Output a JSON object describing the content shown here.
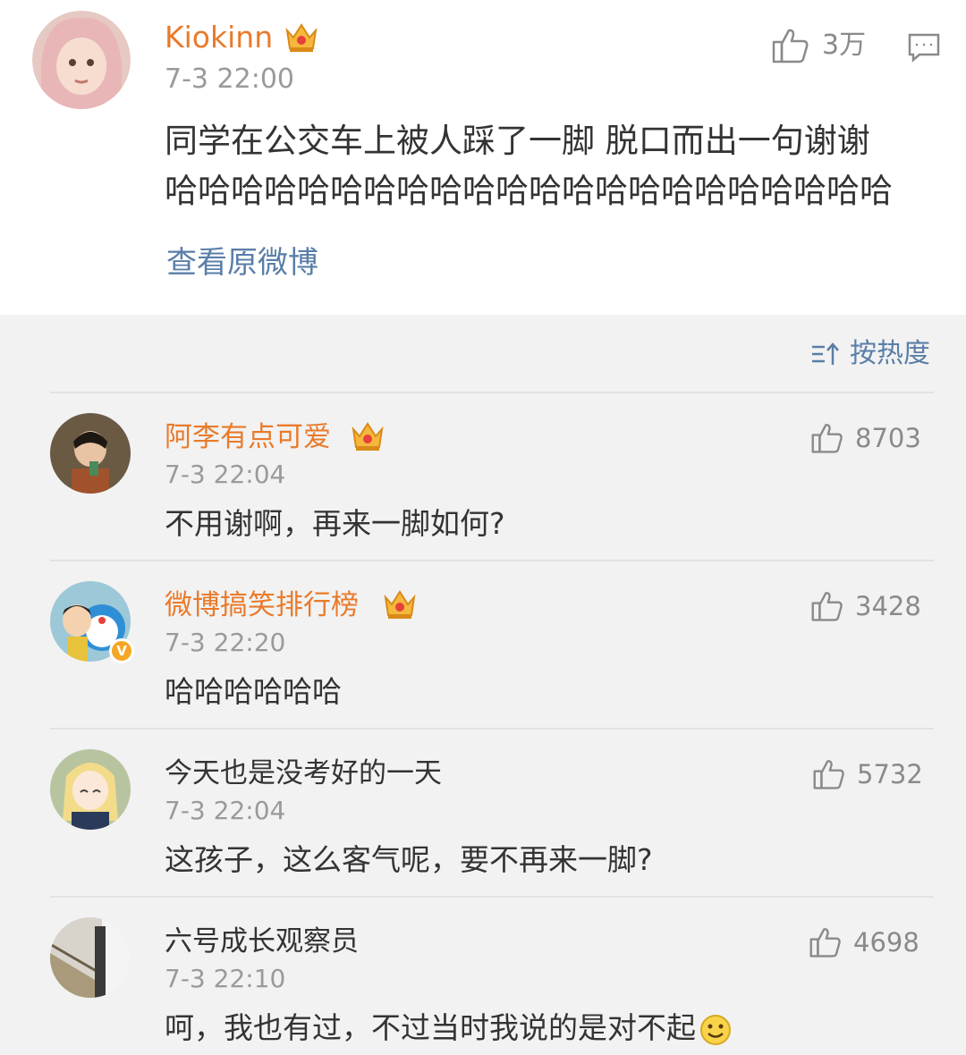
{
  "post": {
    "username": "Kiokinn",
    "time": "7-3 22:00",
    "like_count": "3万",
    "body_line1": "同学在公交车上被人踩了一脚 脱口而出一句谢谢",
    "body_line2": "哈哈哈哈哈哈哈哈哈哈哈哈哈哈哈哈哈哈哈哈哈哈",
    "view_original": "查看原微博"
  },
  "sort": {
    "label": "按热度",
    "icon": "sort-icon"
  },
  "comments": [
    {
      "name": "阿李有点可爱",
      "vip": true,
      "time": "7-3 22:04",
      "text": "不用谢啊，再来一脚如何?",
      "likes": "8703"
    },
    {
      "name": "微博搞笑排行榜",
      "vip": true,
      "verified": true,
      "time": "7-3 22:20",
      "text": "哈哈哈哈哈哈",
      "likes": "3428"
    },
    {
      "name": "今天也是没考好的一天",
      "vip": false,
      "time": "7-3 22:04",
      "text": "这孩子，这么客气呢，要不再来一脚?",
      "likes": "5732"
    },
    {
      "name": "六号成长观察员",
      "vip": false,
      "time": "7-3 22:10",
      "text": "呵，我也有过，不过当时我说的是对不起",
      "likes": "4698",
      "emoji": "smiley-emoji"
    }
  ],
  "colors": {
    "vip_name": "#ea7a2a",
    "link": "#5a7ea8",
    "meta": "#9a9a9a",
    "background": "#f2f2f2"
  }
}
